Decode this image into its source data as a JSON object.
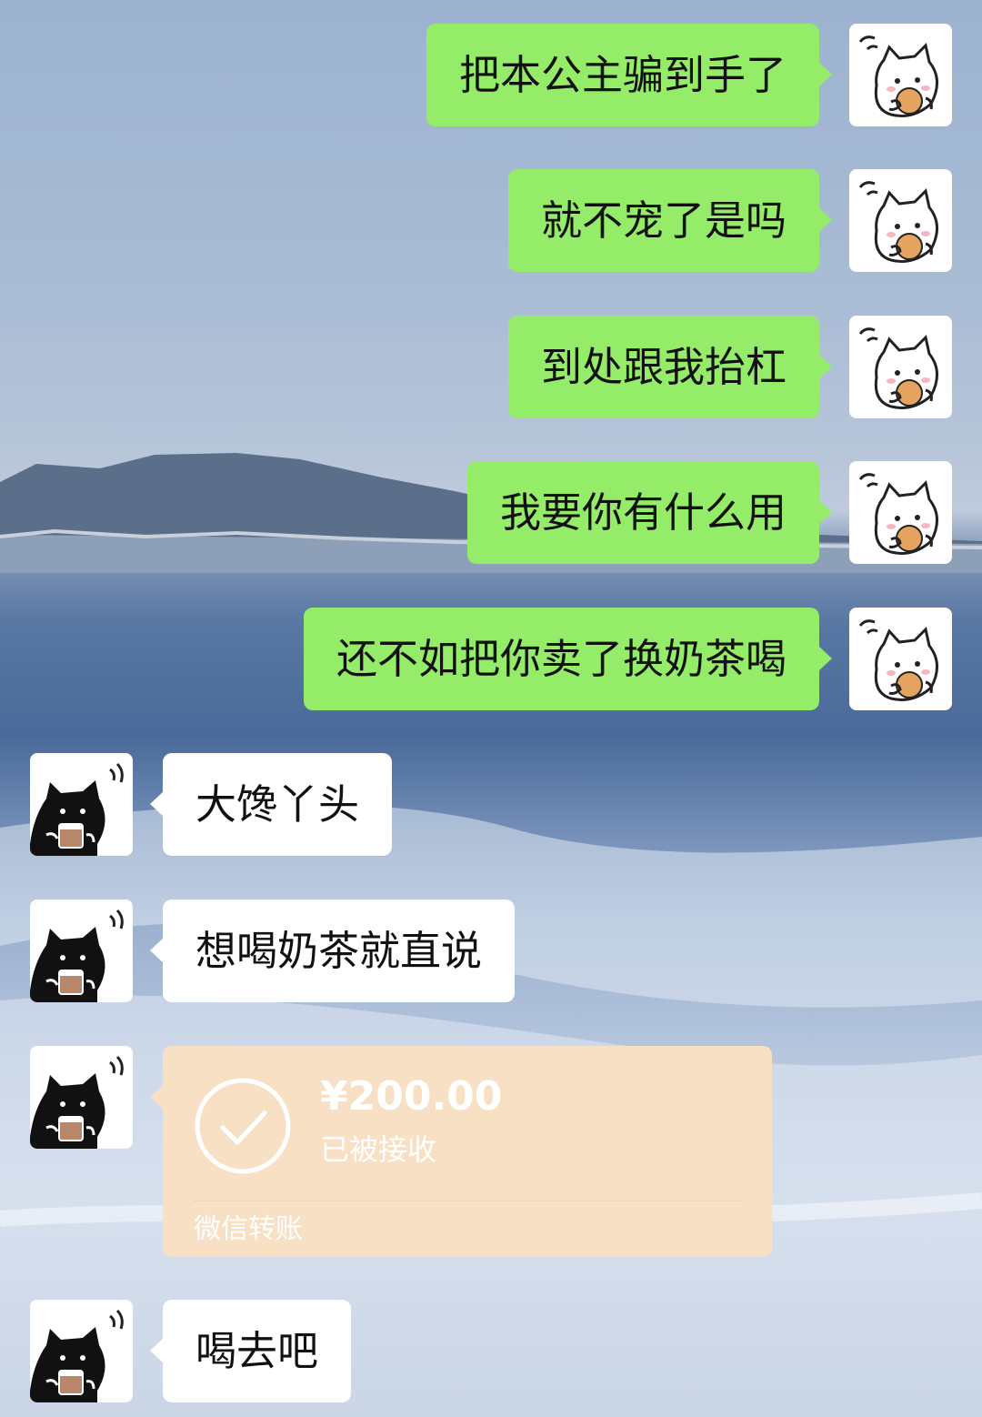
{
  "chat": {
    "outgoing": [
      {
        "text": "把本公主骗到手了"
      },
      {
        "text": "就不宠了是吗"
      },
      {
        "text": "到处跟我抬杠"
      },
      {
        "text": "我要你有什么用"
      },
      {
        "text": "还不如把你卖了换奶茶喝"
      }
    ],
    "incoming": [
      {
        "text": "大馋丫头"
      },
      {
        "text": "想喝奶茶就直说"
      },
      {
        "text": "喝去吧"
      }
    ],
    "transfer": {
      "amount": "¥200.00",
      "status": "已被接收",
      "brand": "微信转账",
      "icon": "check-circle-icon"
    }
  },
  "avatars": {
    "self": "white-cat-icon",
    "contact": "black-cat-icon"
  },
  "colors": {
    "outgoing_bubble": "#95ec69",
    "incoming_bubble": "#ffffff",
    "transfer_bubble": "#f8e0c4"
  }
}
